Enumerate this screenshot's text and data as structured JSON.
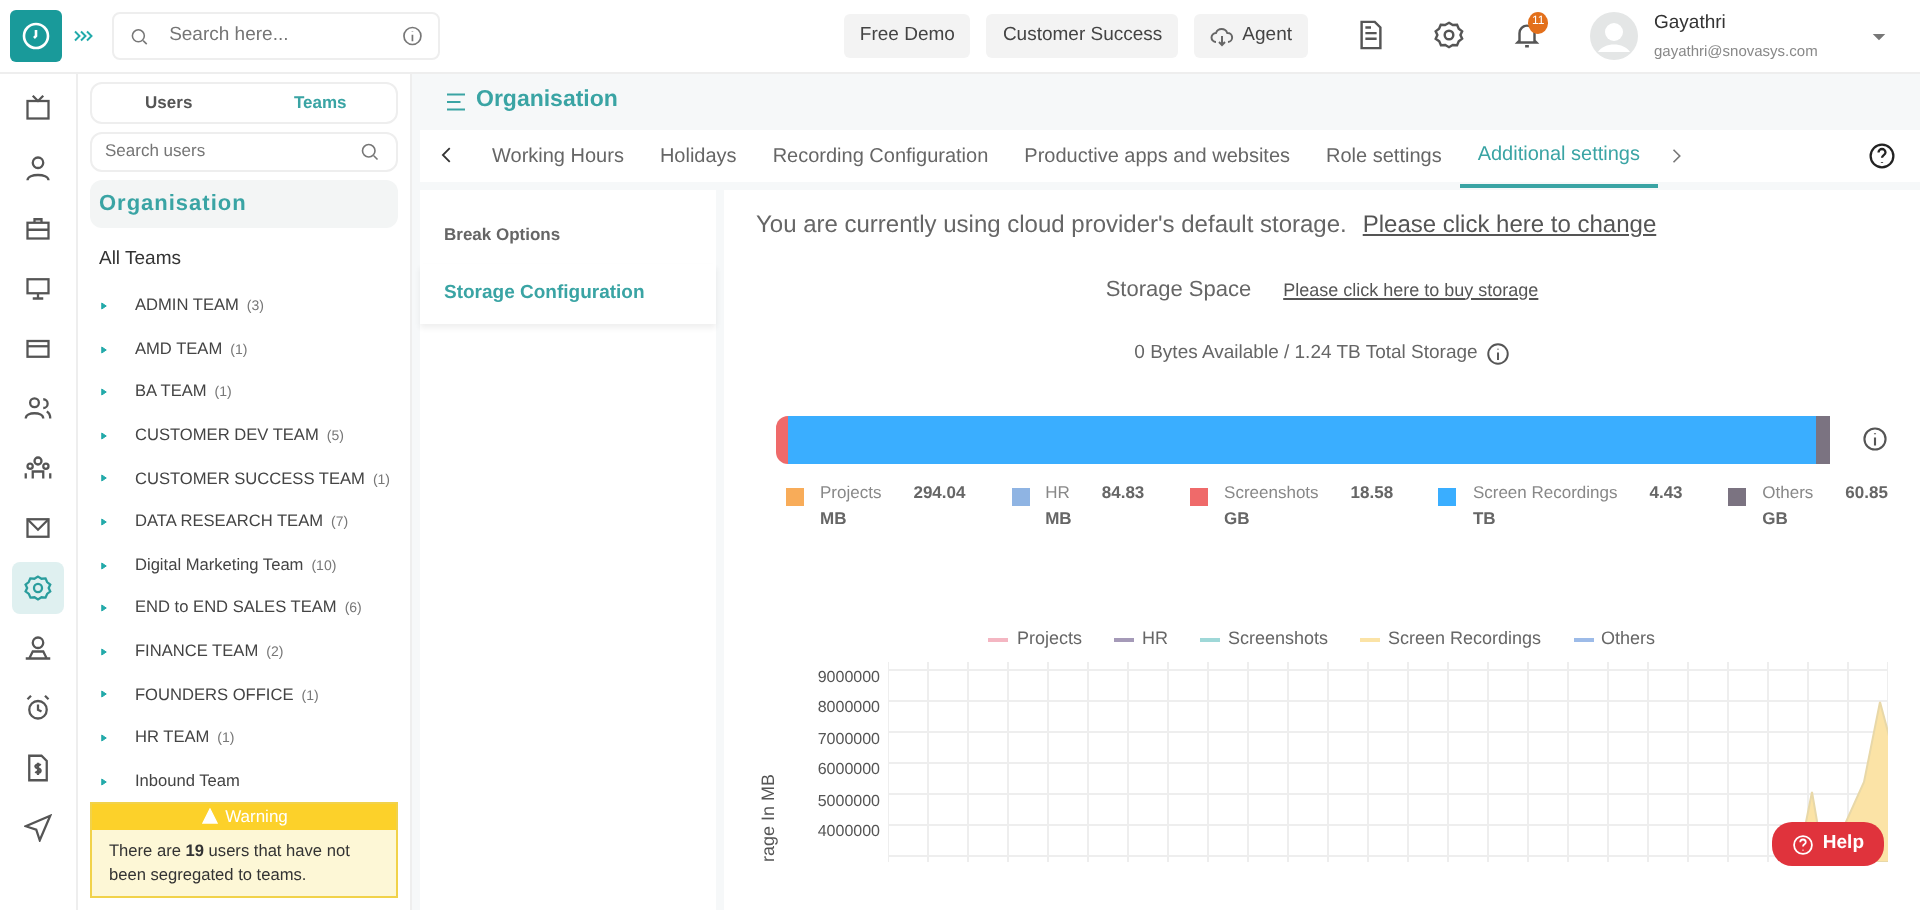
{
  "topbar": {
    "search": {
      "placeholder": "Search here..."
    },
    "buttons": [
      {
        "label": "Free Demo",
        "kind": "plain"
      },
      {
        "label": "Customer Success",
        "kind": "plain"
      },
      {
        "label": "Agent",
        "kind": "cloud"
      }
    ],
    "notifications": "11",
    "user": {
      "name": "Gayathri",
      "email": "gayathri@snovasys.com"
    }
  },
  "rail": [
    {
      "kind": "tv",
      "selected": false
    },
    {
      "kind": "user",
      "selected": false
    },
    {
      "kind": "briefcase",
      "selected": false
    },
    {
      "kind": "monitor",
      "selected": false
    },
    {
      "kind": "card",
      "selected": false
    },
    {
      "kind": "users",
      "selected": false
    },
    {
      "kind": "team",
      "selected": false
    },
    {
      "kind": "mail",
      "selected": false
    },
    {
      "kind": "gear",
      "selected": true
    },
    {
      "kind": "person",
      "selected": false
    },
    {
      "kind": "alarm",
      "selected": false
    },
    {
      "kind": "invoice",
      "selected": false
    },
    {
      "kind": "send",
      "selected": false
    }
  ],
  "sidebar": {
    "tabs": [
      {
        "label": "Users",
        "selected": false
      },
      {
        "label": "Teams",
        "selected": true
      }
    ],
    "search": {
      "placeholder": "Search users"
    },
    "heading": "Organisation",
    "all": "All Teams",
    "teams": [
      {
        "name": "ADMIN TEAM",
        "count": "(3)"
      },
      {
        "name": "AMD TEAM",
        "count": "(1)"
      },
      {
        "name": "BA TEAM",
        "count": "(1)"
      },
      {
        "name": "CUSTOMER DEV TEAM",
        "count": "(5)"
      },
      {
        "name": "CUSTOMER SUCCESS TEAM",
        "count": "(1)"
      },
      {
        "name": "DATA RESEARCH TEAM",
        "count": "(7)"
      },
      {
        "name": "Digital Marketing Team",
        "count": "(10)"
      },
      {
        "name": "END to END SALES TEAM",
        "count": "(6)"
      },
      {
        "name": "FINANCE TEAM",
        "count": "(2)"
      },
      {
        "name": "FOUNDERS OFFICE",
        "count": "(1)"
      },
      {
        "name": "HR TEAM",
        "count": "(1)"
      },
      {
        "name": "Inbound Team"
      }
    ],
    "warning": {
      "title": "Warning",
      "text": "There are **19** users that have not been segregated to teams."
    }
  },
  "page": {
    "title": "Organisation",
    "tabs": [
      {
        "label": "Working Hours",
        "selected": false
      },
      {
        "label": "Holidays",
        "selected": false
      },
      {
        "label": "Recording Configuration",
        "selected": false
      },
      {
        "label": "Productive apps and websites",
        "selected": false
      },
      {
        "label": "Role settings",
        "selected": false
      },
      {
        "label": "Additional settings",
        "selected": true
      }
    ],
    "menu": [
      {
        "label": "Break Options",
        "selected": false
      },
      {
        "label": "Storage Configuration",
        "selected": true
      }
    ],
    "notice": "You are currently using cloud provider's default storage.",
    "notice_link": "Please click here to change",
    "space_label": "Storage Space",
    "buy_link": "Please click here to buy storage",
    "summary": "0 Bytes Available / 1.24 TB Total Storage",
    "segments": [
      {
        "name": "Projects",
        "value": "294.04",
        "unit": "MB",
        "color": "#f8ac59"
      },
      {
        "name": "HR",
        "value": "84.83",
        "unit": "MB",
        "color": "#8fb4e3"
      },
      {
        "name": "Screenshots",
        "value": "18.58",
        "unit": "GB",
        "color": "#ef6a6a"
      },
      {
        "name": "Screen Recordings",
        "value": "4.43",
        "unit": "TB",
        "color": "#3aaeff"
      },
      {
        "name": "Others",
        "value": "60.85",
        "unit": "GB",
        "color": "#7b7381"
      }
    ],
    "chart": {
      "legend": [
        {
          "name": "Projects",
          "color": "#f4b6c2"
        },
        {
          "name": "HR",
          "color": "#a59ab8"
        },
        {
          "name": "Screenshots",
          "color": "#9fd8d8"
        },
        {
          "name": "Screen Recordings",
          "color": "#fbe3a6"
        },
        {
          "name": "Others",
          "color": "#9dbbe8"
        }
      ],
      "yticks": [
        "9000000",
        "8000000",
        "7000000",
        "6000000",
        "5000000",
        "4000000"
      ],
      "ylabel": "rage In MB"
    },
    "help": "Help"
  }
}
